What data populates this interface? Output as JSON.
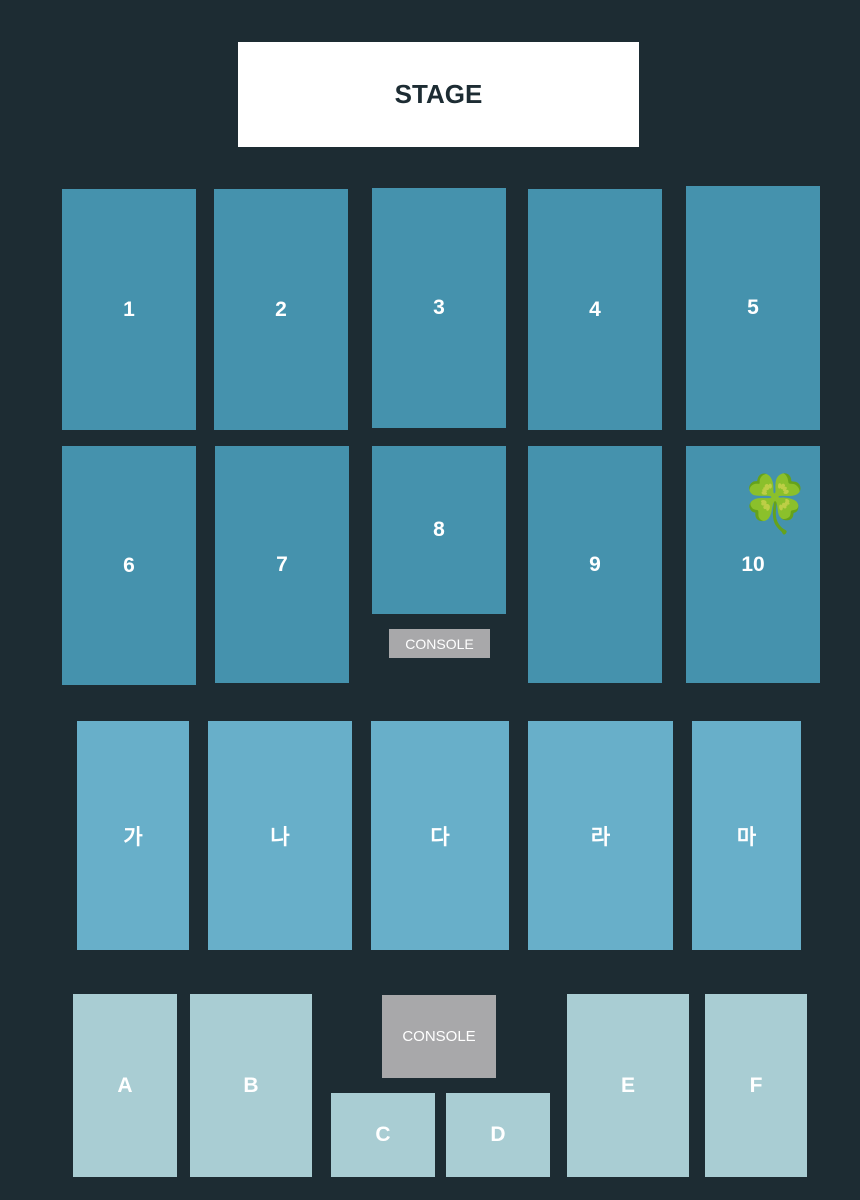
{
  "stage": {
    "label": "STAGE"
  },
  "floor_sections": [
    {
      "label": "1"
    },
    {
      "label": "2"
    },
    {
      "label": "3"
    },
    {
      "label": "4"
    },
    {
      "label": "5"
    },
    {
      "label": "6"
    },
    {
      "label": "7"
    },
    {
      "label": "8"
    },
    {
      "label": "9"
    },
    {
      "label": "10"
    }
  ],
  "mid_sections": [
    {
      "label": "가"
    },
    {
      "label": "나"
    },
    {
      "label": "다"
    },
    {
      "label": "라"
    },
    {
      "label": "마"
    }
  ],
  "back_sections": [
    {
      "label": "A"
    },
    {
      "label": "B"
    },
    {
      "label": "C"
    },
    {
      "label": "D"
    },
    {
      "label": "E"
    },
    {
      "label": "F"
    }
  ],
  "consoles": [
    {
      "label": "CONSOLE"
    },
    {
      "label": "CONSOLE"
    }
  ],
  "marker": {
    "icon": "four-leaf-clover-icon",
    "glyph": "🍀",
    "section": "10"
  },
  "colors": {
    "background": "#1d2c33",
    "floor": "#4592ad",
    "mid": "#68afc9",
    "back": "#a9cdd3",
    "console": "#a8a8aa"
  }
}
